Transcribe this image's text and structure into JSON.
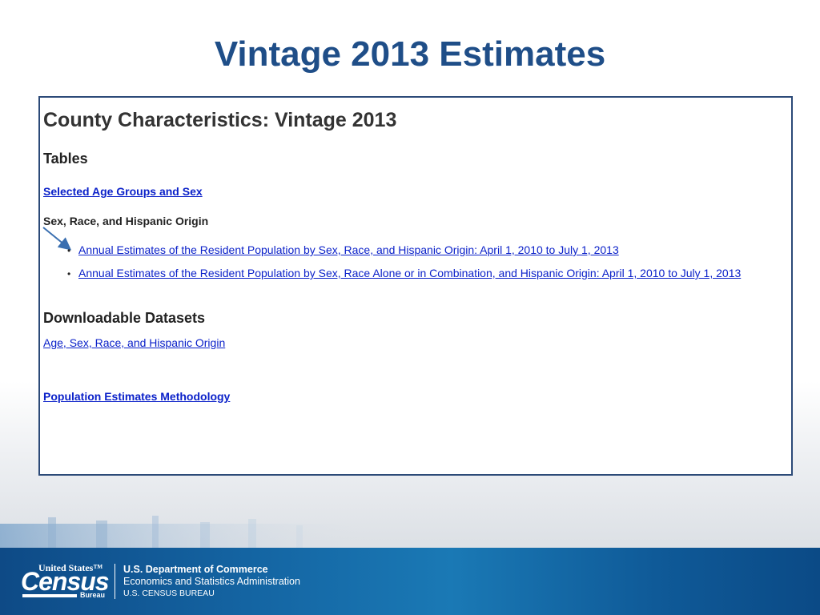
{
  "slide": {
    "title": "Vintage 2013 Estimates"
  },
  "webpage": {
    "heading": "County Characteristics: Vintage 2013",
    "tables_heading": "Tables",
    "selected_age_link": "Selected Age Groups and Sex",
    "subhead": "Sex, Race, and Hispanic Origin",
    "bullets": [
      "Annual Estimates of the Resident Population by Sex, Race, and Hispanic Origin: April 1, 2010 to July 1, 2013",
      "Annual Estimates of the Resident Population by Sex, Race Alone or in Combination, and Hispanic Origin: April 1, 2010 to July 1, 2013"
    ],
    "downloadable_heading": "Downloadable Datasets",
    "dataset_link": "Age, Sex, Race, and Hispanic Origin",
    "methodology_link": "Population Estimates Methodology"
  },
  "footer": {
    "logo_top": "United States™",
    "logo_census": "Census",
    "logo_bureau": "Bureau",
    "dept": "U.S. Department of Commerce",
    "admin": "Economics and Statistics Administration",
    "bureau": "U.S. CENSUS BUREAU"
  },
  "colors": {
    "title": "#1f4e88",
    "link": "#0b21c9",
    "frame_border": "#2c4a78",
    "footer_blue": "#1464a2"
  }
}
